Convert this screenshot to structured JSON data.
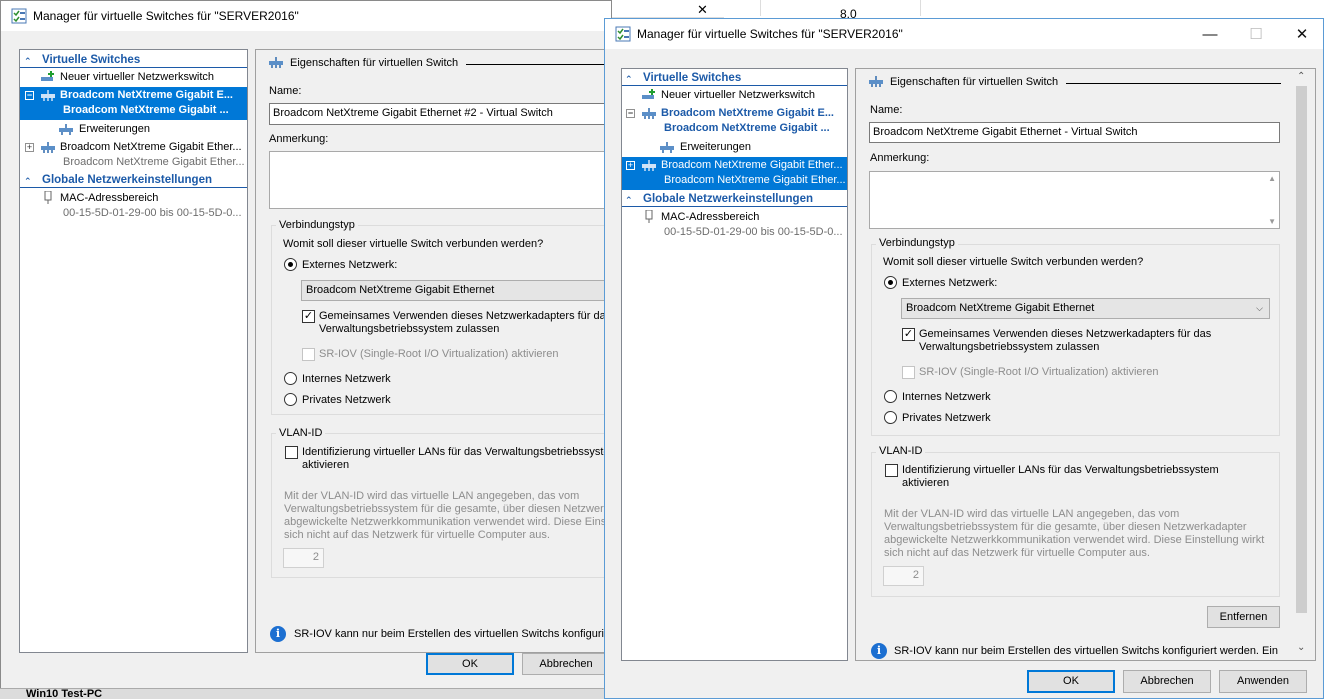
{
  "bg_window": {
    "title_partial_value": "8.0"
  },
  "taskbar": {
    "item_label": "Win10 Test-PC"
  },
  "back_window": {
    "title": "Manager für virtuelle Switches für \"SERVER2016\"",
    "tree": {
      "section_switches": "Virtuelle Switches",
      "new_switch": "Neuer virtueller Netzwerkswitch",
      "switch1_line1": "Broadcom NetXtreme Gigabit E...",
      "switch1_line2": "Broadcom NetXtreme Gigabit ...",
      "extensions": "Erweiterungen",
      "switch2_line1": "Broadcom NetXtreme Gigabit Ether...",
      "switch2_line2": "Broadcom NetXtreme Gigabit Ether...",
      "section_global": "Globale Netzwerkeinstellungen",
      "mac": "MAC-Adressbereich",
      "mac_range": "00-15-5D-01-29-00 bis 00-15-5D-0..."
    },
    "panel": {
      "heading": "Eigenschaften für virtuellen Switch",
      "name_label": "Name:",
      "name_value": "Broadcom NetXtreme Gigabit Ethernet #2 - Virtual Switch",
      "note_label": "Anmerkung:",
      "conn_group": "Verbindungstyp",
      "conn_question": "Womit soll dieser virtuelle Switch verbunden werden?",
      "external": "Externes Netzwerk:",
      "adapter": "Broadcom NetXtreme Gigabit Ethernet",
      "share_line1": "Gemeinsames Verwenden dieses Netzwerkadapters für das",
      "share_line2": "Verwaltungsbetriebssystem zulassen",
      "sriov": "SR-IOV (Single-Root I/O Virtualization) aktivieren",
      "internal": "Internes Netzwerk",
      "private": "Privates Netzwerk",
      "vlan_group": "VLAN-ID",
      "vlan_line1": "Identifizierung virtueller LANs für das Verwaltungsbetriebssyste",
      "vlan_line2": "aktivieren",
      "vlan_desc1": "Mit der VLAN-ID wird das virtuelle LAN angegeben, das vom",
      "vlan_desc2": "Verwaltungsbetriebssystem für die gesamte, über diesen Netzwerk",
      "vlan_desc3": "abgewickelte Netzwerkkommunikation verwendet wird. Diese Einste",
      "vlan_desc4": "sich nicht auf das Netzwerk für virtuelle Computer aus.",
      "vlan_value": "2",
      "info": "SR-IOV kann nur beim Erstellen des virtuellen Switchs konfigurier"
    },
    "buttons": {
      "ok": "OK",
      "cancel": "Abbrechen"
    }
  },
  "front_window": {
    "title": "Manager für virtuelle Switches für \"SERVER2016\"",
    "tree": {
      "section_switches": "Virtuelle Switches",
      "new_switch": "Neuer virtueller Netzwerkswitch",
      "switch1_line1": "Broadcom NetXtreme Gigabit E...",
      "switch1_line2": "Broadcom NetXtreme Gigabit ...",
      "extensions": "Erweiterungen",
      "switch2_line1": "Broadcom NetXtreme Gigabit Ether...",
      "switch2_line2": "Broadcom NetXtreme Gigabit Ether...",
      "section_global": "Globale Netzwerkeinstellungen",
      "mac": "MAC-Adressbereich",
      "mac_range": "00-15-5D-01-29-00 bis 00-15-5D-0..."
    },
    "panel": {
      "heading": "Eigenschaften für virtuellen Switch",
      "name_label": "Name:",
      "name_value": "Broadcom NetXtreme Gigabit Ethernet - Virtual Switch",
      "note_label": "Anmerkung:",
      "conn_group": "Verbindungstyp",
      "conn_question": "Womit soll dieser virtuelle Switch verbunden werden?",
      "external": "Externes Netzwerk:",
      "adapter": "Broadcom NetXtreme Gigabit Ethernet",
      "share_line1": "Gemeinsames Verwenden dieses Netzwerkadapters für das",
      "share_line2": "Verwaltungsbetriebssystem zulassen",
      "sriov": "SR-IOV (Single-Root I/O Virtualization) aktivieren",
      "internal": "Internes Netzwerk",
      "private": "Privates Netzwerk",
      "vlan_group": "VLAN-ID",
      "vlan_line1": "Identifizierung virtueller LANs für das Verwaltungsbetriebssystem",
      "vlan_line2": "aktivieren",
      "vlan_desc1": "Mit der VLAN-ID wird das virtuelle LAN angegeben, das vom",
      "vlan_desc2": "Verwaltungsbetriebssystem für die gesamte, über diesen Netzwerkadapter",
      "vlan_desc3": "abgewickelte Netzwerkkommunikation verwendet wird. Diese Einstellung wirkt",
      "vlan_desc4": "sich nicht auf das Netzwerk für virtuelle Computer aus.",
      "vlan_value": "2",
      "remove": "Entfernen",
      "info": "SR-IOV kann nur beim Erstellen des virtuellen Switchs konfiguriert werden. Ein"
    },
    "buttons": {
      "ok": "OK",
      "cancel": "Abbrechen",
      "apply": "Anwenden"
    }
  }
}
